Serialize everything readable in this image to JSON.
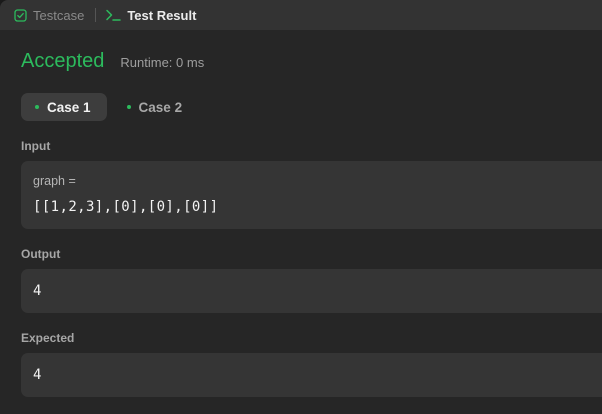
{
  "tabs": {
    "testcase_label": "Testcase",
    "result_label": "Test Result"
  },
  "result": {
    "status": "Accepted",
    "runtime": "Runtime: 0 ms"
  },
  "cases": [
    {
      "label": "Case 1",
      "active": true
    },
    {
      "label": "Case 2",
      "active": false
    }
  ],
  "input": {
    "label": "Input",
    "var_name": "graph =",
    "value": "[[1,2,3],[0],[0],[0]]"
  },
  "output": {
    "label": "Output",
    "value": "4"
  },
  "expected": {
    "label": "Expected",
    "value": "4"
  },
  "colors": {
    "accent_green": "#2cbb5d",
    "panel_bg": "#262626",
    "box_bg": "#353535"
  },
  "icons": {
    "testcase": "checkbox-icon",
    "result": "terminal-prompt-icon"
  }
}
